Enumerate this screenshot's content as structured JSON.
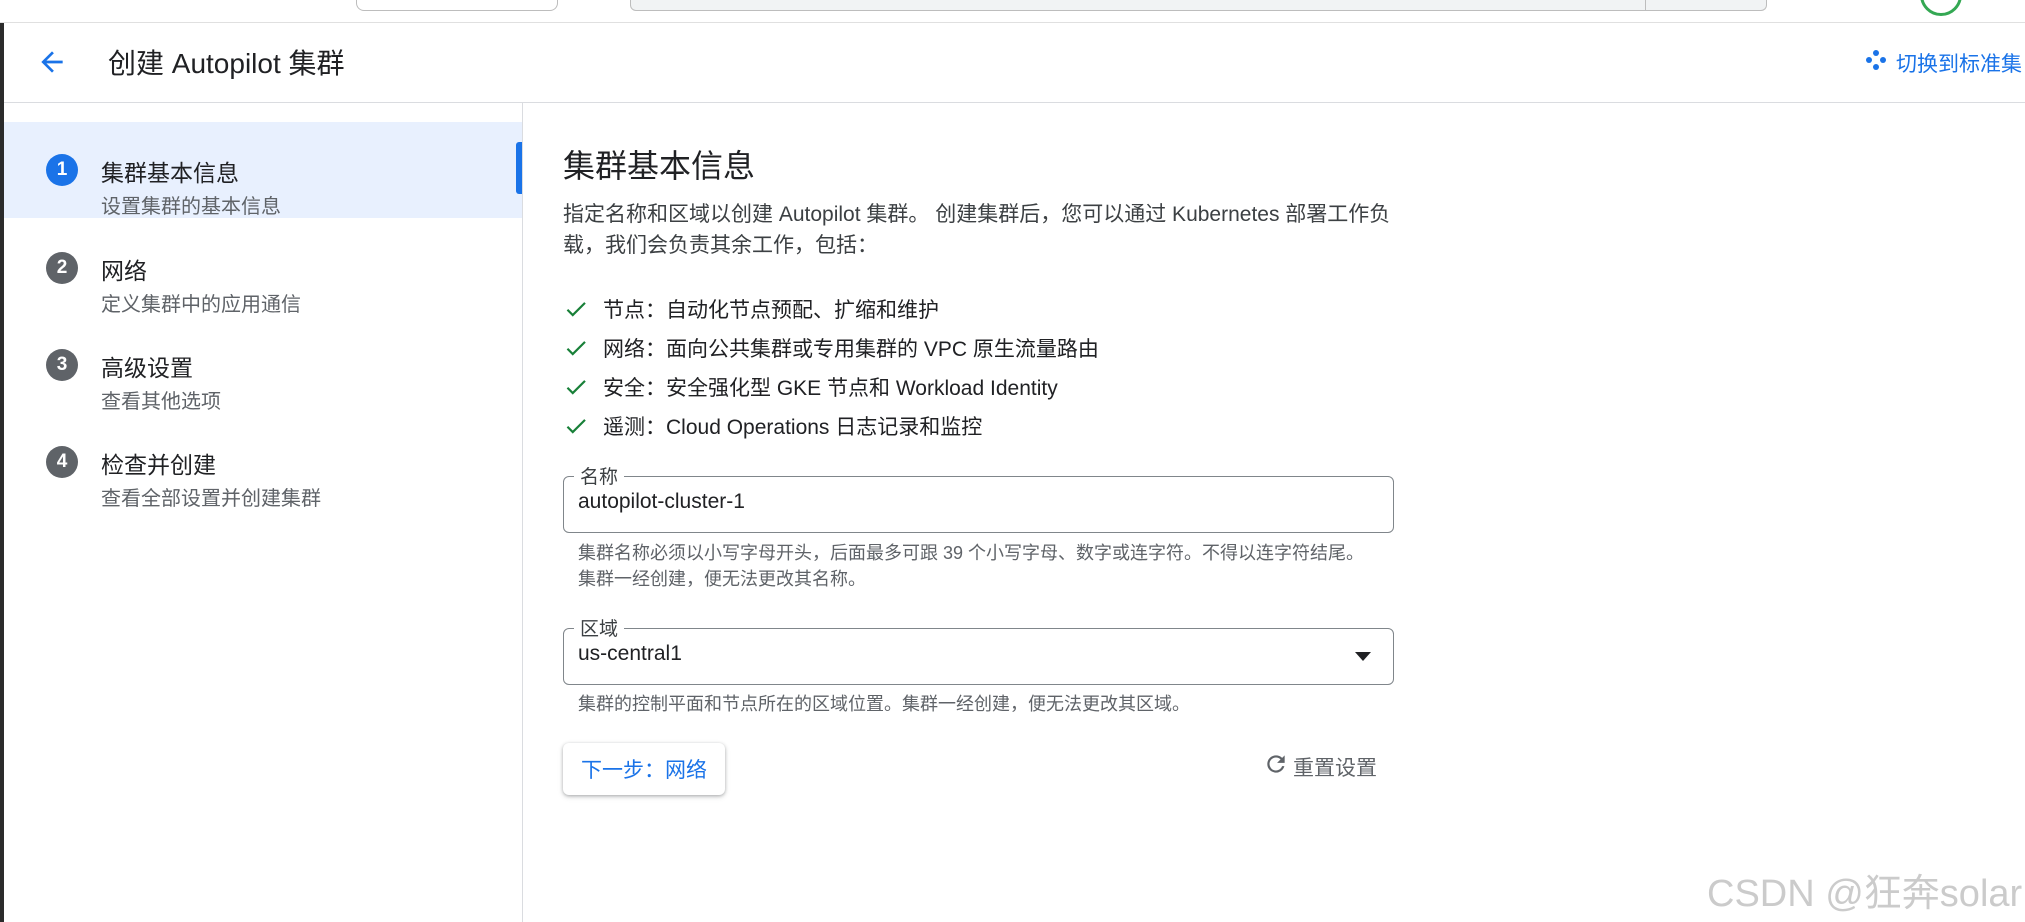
{
  "header": {
    "title": "创建 Autopilot 集群",
    "switch_link": "切换到标准集"
  },
  "sidebar": {
    "steps": [
      {
        "number": "1",
        "title": "集群基本信息",
        "subtitle": "设置集群的基本信息",
        "active": true
      },
      {
        "number": "2",
        "title": "网络",
        "subtitle": "定义集群中的应用通信",
        "active": false
      },
      {
        "number": "3",
        "title": "高级设置",
        "subtitle": "查看其他选项",
        "active": false
      },
      {
        "number": "4",
        "title": "检查并创建",
        "subtitle": "查看全部设置并创建集群",
        "active": false
      }
    ]
  },
  "main": {
    "title": "集群基本信息",
    "description": "指定名称和区域以创建 Autopilot 集群。 创建集群后，您可以通过 Kubernetes 部署工作负载，我们会负责其余工作，包括：",
    "features": [
      "节点：自动化节点预配、扩缩和维护",
      "网络：面向公共集群或专用集群的 VPC 原生流量路由",
      "安全：安全强化型 GKE 节点和 Workload Identity",
      "遥测：Cloud Operations 日志记录和监控"
    ],
    "name_field": {
      "label": "名称",
      "value": "autopilot-cluster-1",
      "hint": "集群名称必须以小写字母开头，后面最多可跟 39 个小写字母、数字或连字符。不得以连字符结尾。集群一经创建，便无法更改其名称。"
    },
    "region_field": {
      "label": "区域",
      "value": "us-central1",
      "hint": "集群的控制平面和节点所在的区域位置。集群一经创建，便无法更改其区域。"
    },
    "next_button": "下一步：网络",
    "reset_button": "重置设置"
  },
  "watermark": "CSDN @狂奔solar",
  "colors": {
    "accent": "#1a73e8",
    "check": "#188038",
    "active_bg": "#e8f0fe",
    "muted_text": "#5f6368"
  },
  "icons": {
    "back": "arrow-back-icon",
    "switch": "dots-cluster-icon",
    "check": "checkmark-icon",
    "dropdown": "caret-down-icon",
    "reset": "refresh-icon"
  }
}
